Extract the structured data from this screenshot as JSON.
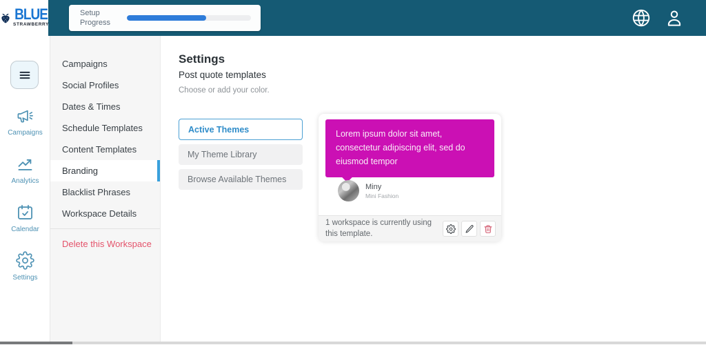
{
  "colors": {
    "header_bg": "#155A74",
    "accent_blue": "#39A0DC",
    "progress_fill": "#2E7CD9",
    "rail_blue": "#4E92B4",
    "logo_blue": "#1A76D2",
    "danger_red": "#E4536B",
    "quote_magenta": "#CB10B4"
  },
  "header": {
    "logo_line1": "BLUE",
    "logo_line2": "STRAWBERRY",
    "setup_progress": {
      "label": "Setup Progress",
      "percent": 64
    }
  },
  "icon_rail": {
    "items": [
      {
        "label": "Campaigns",
        "icon": "megaphone-icon"
      },
      {
        "label": "Analytics",
        "icon": "trend-up-icon"
      },
      {
        "label": "Calendar",
        "icon": "calendar-check-icon"
      },
      {
        "label": "Settings",
        "icon": "gear-icon"
      }
    ]
  },
  "settings_nav": {
    "items": [
      "Campaigns",
      "Social Profiles",
      "Dates & Times",
      "Schedule Templates",
      "Content Templates",
      "Branding",
      "Blacklist Phrases",
      "Workspace Details"
    ],
    "active_item": "Branding",
    "danger_item": "Delete this Workspace"
  },
  "main": {
    "title": "Settings",
    "subtitle": "Post quote templates",
    "hint": "Choose or add your color.",
    "theme_tabs": [
      {
        "label": "Active Themes",
        "active": true
      },
      {
        "label": "My Theme Library",
        "active": false
      },
      {
        "label": "Browse Available Themes",
        "active": false
      }
    ],
    "template_card": {
      "quote": "Lorem ipsum dolor sit amet, consectetur adipiscing elit, sed do eiusmod tempor",
      "author_name": "Miny",
      "author_subtitle": "Mini Fashion",
      "usage_text": "1 workspace is currently using this template.",
      "quote_color": "#CB10B4"
    }
  }
}
